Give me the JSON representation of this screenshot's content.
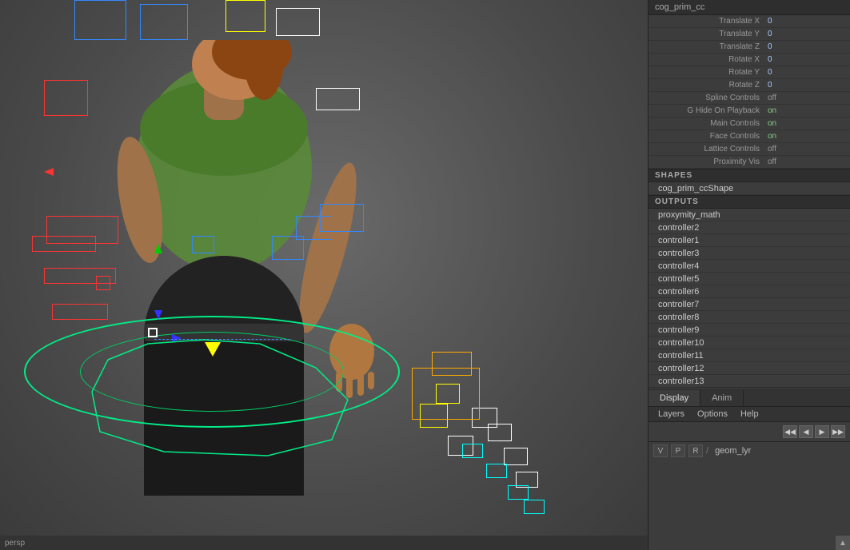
{
  "title": "cog_prim_cc",
  "attributes": [
    {
      "label": "Translate X",
      "value": "0",
      "type": "num"
    },
    {
      "label": "Translate Y",
      "value": "0",
      "type": "num"
    },
    {
      "label": "Translate Z",
      "value": "0",
      "type": "num"
    },
    {
      "label": "Rotate X",
      "value": "0",
      "type": "num"
    },
    {
      "label": "Rotate Y",
      "value": "0",
      "type": "num"
    },
    {
      "label": "Rotate Z",
      "value": "0",
      "type": "num"
    },
    {
      "label": "Spline Controls",
      "value": "off",
      "type": "off"
    },
    {
      "label": "G Hide On Playback",
      "value": "on",
      "type": "on"
    },
    {
      "label": "Main Controls",
      "value": "on",
      "type": "on"
    },
    {
      "label": "Face Controls",
      "value": "on",
      "type": "on"
    },
    {
      "label": "Lattice Controls",
      "value": "off",
      "type": "off"
    },
    {
      "label": "Proximity Vis",
      "value": "off",
      "type": "off"
    }
  ],
  "shapes_header": "SHAPES",
  "shapes": [
    "cog_prim_ccShape"
  ],
  "outputs_header": "OUTPUTS",
  "outputs": [
    "proxymity_math",
    "controller2",
    "controller1",
    "controller3",
    "controller4",
    "controller5",
    "controller6",
    "controller7",
    "controller8",
    "controller9",
    "controller10",
    "controller11",
    "controller12",
    "controller13"
  ],
  "tabs": [
    "Display",
    "Anim"
  ],
  "active_tab": "Display",
  "menu_items": [
    "Layers",
    "Options",
    "Help"
  ],
  "layer_buttons": [
    "V",
    "P",
    "R"
  ],
  "layer_name": "geom_lyr",
  "bottom_bar_text": "persp",
  "layer_icon_arrows": [
    "◀◀",
    "◀",
    "▶",
    "▶▶"
  ]
}
